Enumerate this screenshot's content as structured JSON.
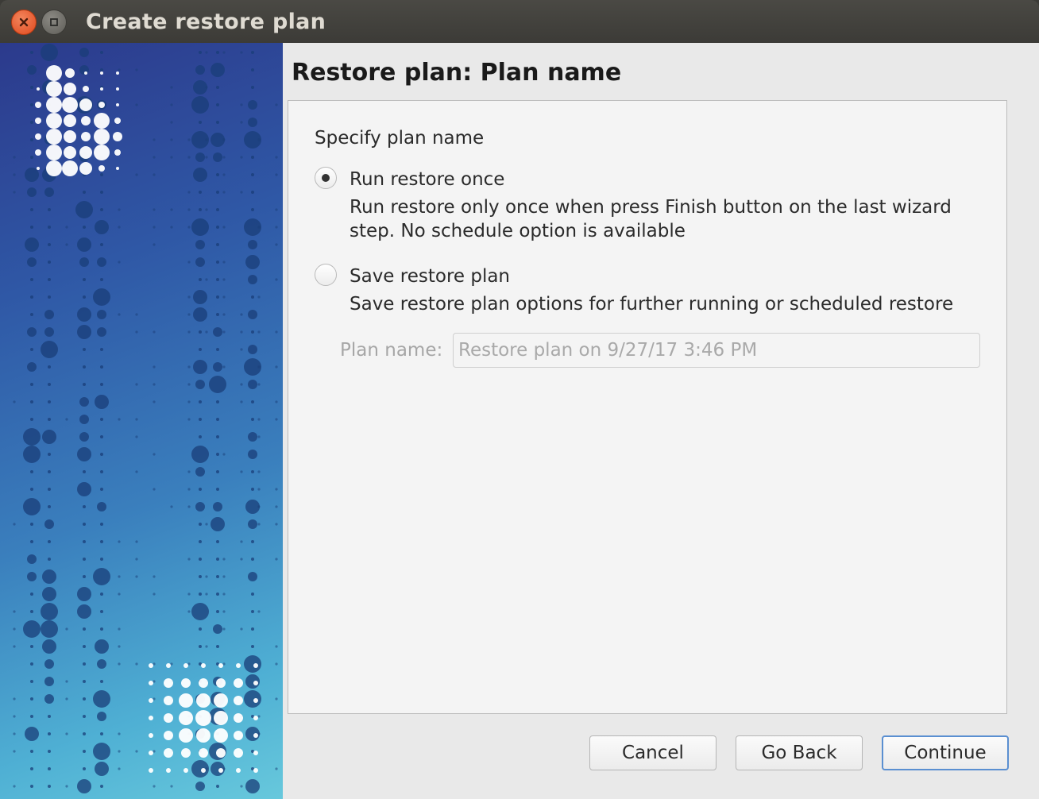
{
  "window": {
    "title": "Create restore plan",
    "close_icon": "close-icon",
    "minimize_icon": "minimize-icon"
  },
  "page": {
    "heading": "Restore plan: Plan name",
    "section_label": "Specify plan name",
    "options": [
      {
        "label": "Run restore once",
        "description": "Run restore only once when press Finish button on the last wizard step. No schedule option is available",
        "selected": true
      },
      {
        "label": "Save restore plan",
        "description": "Save restore plan options for further running or scheduled restore",
        "selected": false
      }
    ],
    "plan_name": {
      "label": "Plan name:",
      "value": "Restore plan on 9/27/17 3:46 PM",
      "enabled": false
    }
  },
  "buttons": {
    "cancel": "Cancel",
    "back": "Go Back",
    "continue": "Continue"
  },
  "colors": {
    "banner_top": "#2c3a8c",
    "banner_bottom": "#67c8dc",
    "close_button": "#e0491e"
  }
}
